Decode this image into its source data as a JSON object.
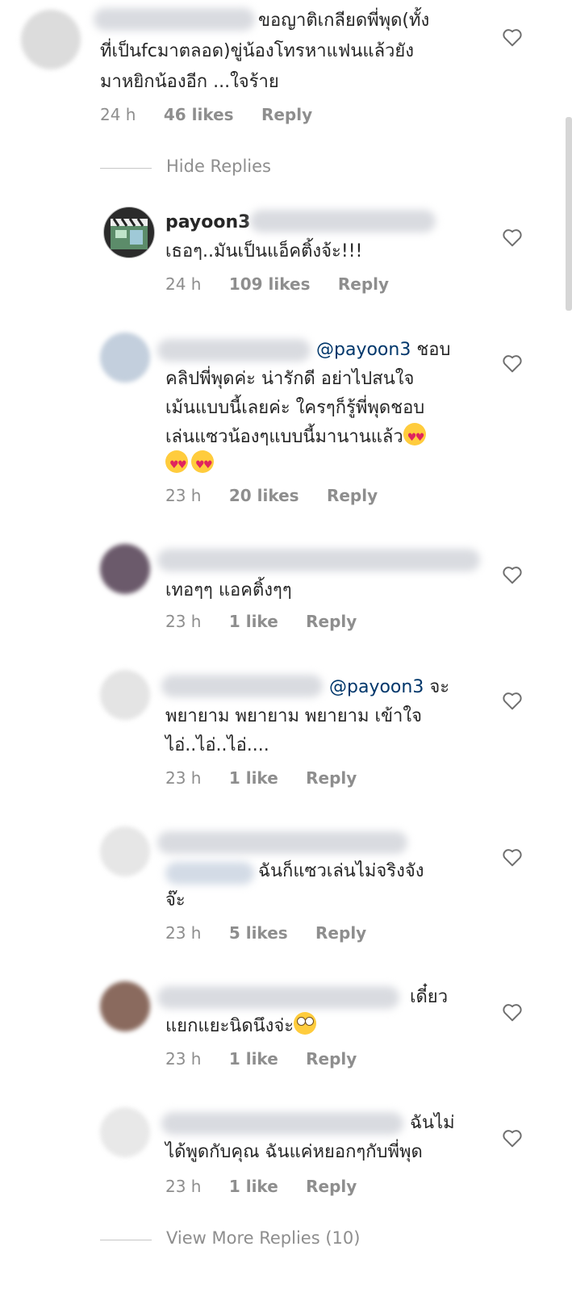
{
  "top_comment": {
    "text": "ขอญาติเกลียดพี่พุด(ทั้งที่เป็นfcมาตลอด)ขู่น้องโทรหาแฟนแล้วยังมาหยิกน้องอีก ...ใจร้าย",
    "line1": "ขอญาติเกลียดพี่พุด(ทั้ง",
    "line2": "ที่เป็นfcมาตลอด)ขู่น้องโทรหาแฟนแล้วยัง",
    "line3": "มาหยิกน้องอีก ...ใจร้าย",
    "time": "24 h",
    "likes": "46 likes",
    "reply": "Reply"
  },
  "hide_replies": "Hide Replies",
  "replies": [
    {
      "username": "payoon3",
      "line1": "เธอๆ..มันเป็นแอ็คติ้งจ้ะ!!!",
      "time": "24 h",
      "likes": "109 likes",
      "reply": "Reply"
    },
    {
      "mention": "@payoon3",
      "line1_tail": "ชอบ",
      "line2": "คลิปพี่พุดค่ะ น่ารักดี อย่าไปสนใจ",
      "line3": "เม้นแบบนี้เลยค่ะ ใครๆก็รู้พี่พุดชอบ",
      "line4": "เล่นแซวน้องๆแบบนี้มานานแล้ว",
      "time": "23 h",
      "likes": "20 likes",
      "reply": "Reply"
    },
    {
      "line1": "เทอๆๆ แอคติ้งๆๆ",
      "time": "23 h",
      "likes": "1 like",
      "reply": "Reply"
    },
    {
      "mention": "@payoon3",
      "line1_tail": "จะ",
      "line2": "พยายาม พยายาม พยายาม เข้าใจ",
      "line3": "ไอ่..ไอ่..ไอ่....",
      "time": "23 h",
      "likes": "1 like",
      "reply": "Reply"
    },
    {
      "line1_tail": "ฉันก็แซวเล่นไม่จริงจัง",
      "line2": "จ๊ะ",
      "time": "23 h",
      "likes": "5 likes",
      "reply": "Reply"
    },
    {
      "line1_tail": "เดี๋ยว",
      "line2": "แยกแยะนิดนึงจ่ะ",
      "time": "23 h",
      "likes": "1 like",
      "reply": "Reply"
    },
    {
      "line1_tail": "ฉันไม่",
      "line2": "ได้พูดกับคุณ ฉันแค่หยอกๆกับพี่พุด",
      "time": "23 h",
      "likes": "1 like",
      "reply": "Reply"
    }
  ],
  "view_more": "View More Replies (10)",
  "icons": {
    "like": "heart-outline-icon"
  },
  "colors": {
    "text": "#262626",
    "meta": "#8e8e8e",
    "mention": "#00376b"
  }
}
